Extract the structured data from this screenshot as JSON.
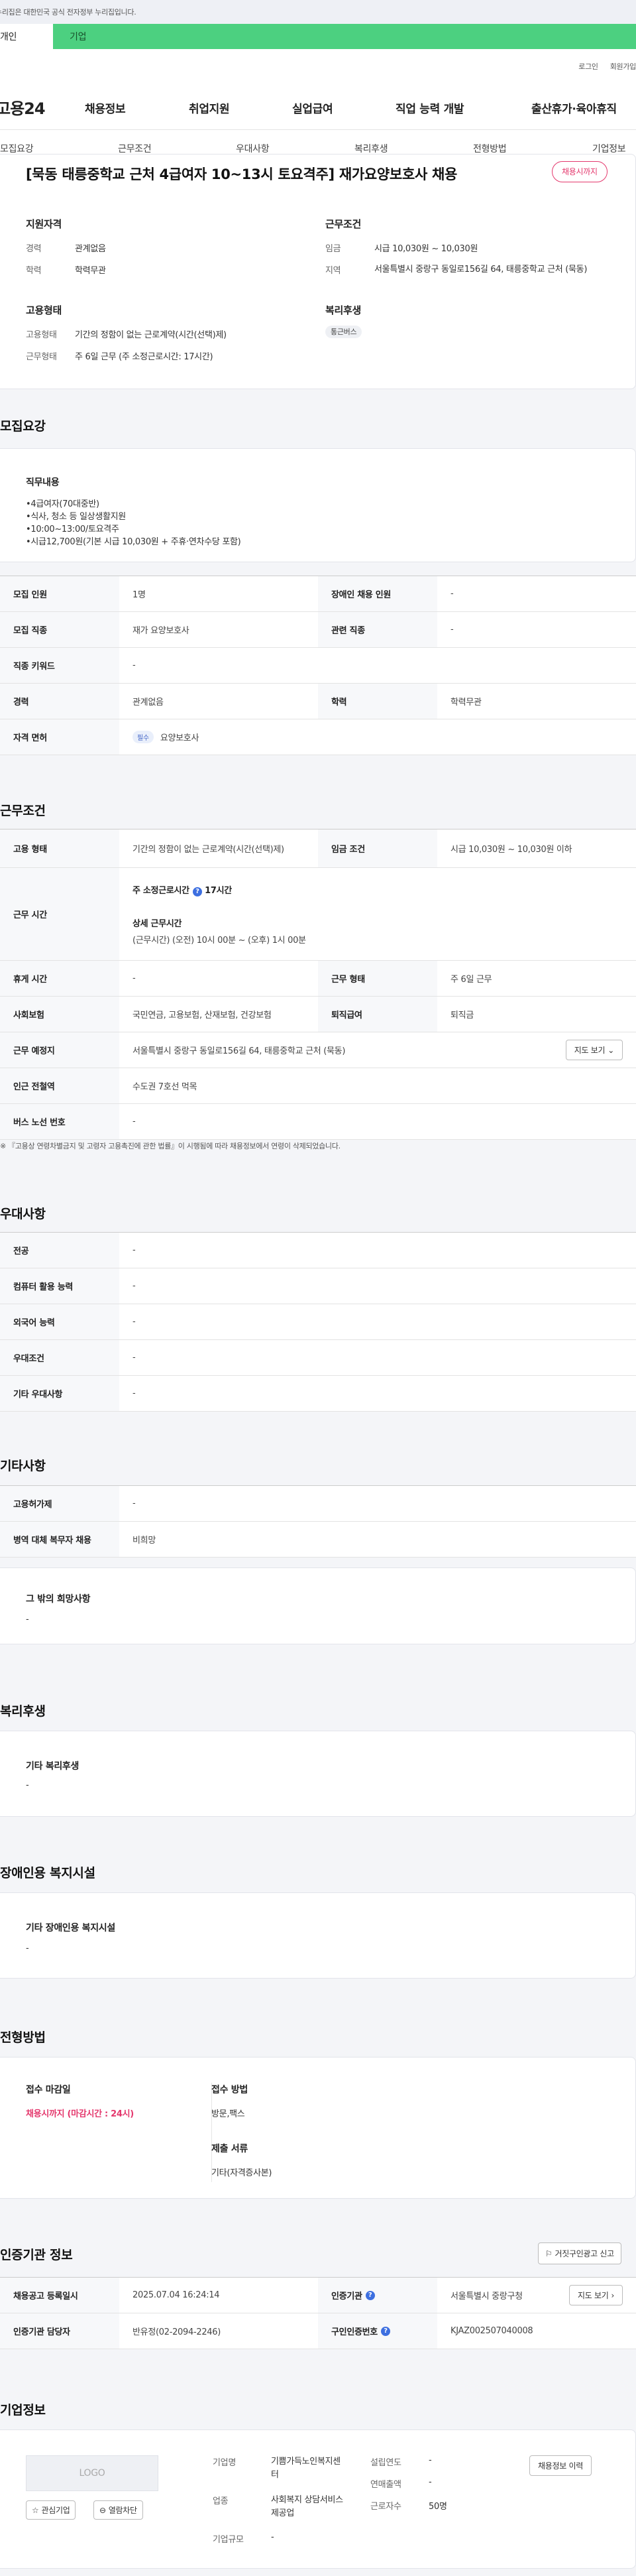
{
  "gov_banner": "이 누리집은 대한민국 공식 전자정부 누리집입니다.",
  "service_tabs": [
    "개인",
    "기업"
  ],
  "utility": [
    "로그인",
    "회원가입"
  ],
  "logo": "고용24",
  "gnb": [
    "채용정보",
    "취업지원",
    "실업급여",
    "직업 능력 개발",
    "출산휴가·육아휴직"
  ],
  "tabs": [
    "모집요강",
    "근무조건",
    "우대사항",
    "복리후생",
    "전형방법",
    "기업정보"
  ],
  "job": {
    "title": "[묵동 태릉중학교 근처 4급여자 10~13시 토요격주] 재가요양보호사 채용",
    "status": "채용시까지",
    "qualification_heading": "지원자격",
    "career_label": "경력",
    "career": "관계없음",
    "education_label": "학력",
    "education": "학력무관",
    "employment_heading": "고용형태",
    "emp_type_label": "고용형태",
    "emp_type": "기간의 정함이 없는 근로계약(시간(선택)제)",
    "work_form_label": "근무형태",
    "work_form": "주 6일 근무 (주 소정근로시간: 17시간)",
    "conditions_heading": "근무조건",
    "wage_label": "임금",
    "wage": "시급 10,030원 ~ 10,030원",
    "region_label": "지역",
    "region": "서울특별시 중랑구 동일로156길 64, 태릉중학교 근처 (묵동)",
    "welfare_heading": "복리후생",
    "welfare_tag": "통근버스"
  },
  "recruit": {
    "section": "모집요강",
    "duty_heading": "직무내용",
    "duty_lines": [
      "•4급여자(70대중반)",
      "•식사, 청소 등 일상생활지원",
      "•10:00~13:00/토요격주",
      "•시급12,700원(기본 시급 10,030원 + 주휴·연차수당 포함)"
    ],
    "rows": [
      {
        "k1": "모집 인원",
        "v1": "1명",
        "k2": "장애인 채용 인원",
        "v2": "-"
      },
      {
        "k1": "모집 직종",
        "v1": "재가 요양보호사",
        "k2": "관련 직종",
        "v2": "-"
      }
    ],
    "keyword_label": "직종 키워드",
    "keyword": "-",
    "career_label": "경력",
    "career": "관계없음",
    "edu_label": "학력",
    "edu": "학력무관",
    "license_label": "자격 면허",
    "license_tag": "필수",
    "license": "요양보호사"
  },
  "work": {
    "section": "근무조건",
    "emp_label": "고용 형태",
    "emp": "기간의 정함이 없는 근로계약(시간(선택)제)",
    "wage_label": "임금 조건",
    "wage": "시급 10,030원 ~ 10,030원 이하",
    "hours_label": "근무 시간",
    "weekly_label": "주 소정근로시간",
    "weekly": "17시간",
    "detail_label": "상세 근무시간",
    "detail": "(근무시간) (오전) 10시 00분 ~ (오후) 1시 00분",
    "break_label": "휴게 시간",
    "break": "-",
    "form_label": "근무 형태",
    "form": "주 6일 근무",
    "insurance_label": "사회보험",
    "insurance": "국민연금, 고용보험, 산재보험, 건강보험",
    "severance_label": "퇴직급여",
    "severance": "퇴직금",
    "place_label": "근무 예정지",
    "place": "서울특별시 중랑구 동일로156길 64, 태릉중학교 근처 (묵동)",
    "map_btn": "지도 보기",
    "subway_label": "인근 전철역",
    "subway": "수도권 7호선 먹목",
    "bus_label": "버스 노선 번호",
    "bus": "-",
    "note": "※ 『고용상 연령차별금지 및 고령자 고용촉진에 관한 법률』이 시행됨에 따라 채용정보에서 연령이 삭제되었습니다."
  },
  "pref": {
    "section": "우대사항",
    "rows": [
      {
        "k": "전공",
        "v": "-"
      },
      {
        "k": "컴퓨터 활용 능력",
        "v": "-"
      },
      {
        "k": "외국어 능력",
        "v": "-"
      },
      {
        "k": "우대조건",
        "v": "-"
      },
      {
        "k": "기타 우대사항",
        "v": "-"
      }
    ]
  },
  "etc": {
    "section": "기타사항",
    "rows": [
      {
        "k": "고용허가제",
        "v": "-"
      },
      {
        "k": "병역 대체 복무자 채용",
        "v": "비희망"
      }
    ],
    "other_heading": "그 밖의 희망사항",
    "other": "-"
  },
  "benefit": {
    "section": "복리후생",
    "heading": "기타 복리후생",
    "value": "-"
  },
  "disability": {
    "section": "장애인용 복지시설",
    "heading": "기타 장애인용 복지시설",
    "value": "-"
  },
  "selection": {
    "section": "전형방법",
    "deadline_label": "접수 마감일",
    "deadline": "채용시까지 (마감시간 : 24시)",
    "method_label": "접수 방법",
    "method": "방문,팩스",
    "docs_label": "제출 서류",
    "docs": "기타(자격증사본)"
  },
  "cert": {
    "section": "인증기관 정보",
    "report_btn": "거짓구인광고 신고",
    "reg_label": "채용공고 등록일시",
    "reg": "2025.07.04 16:24:14",
    "org_label": "인증기관",
    "org": "서울특별시 중랑구청",
    "contact_label": "인증기관 담당자",
    "contact": "반유정(02-2094-2246)",
    "num_label": "구인인증번호",
    "num": "KJAZ002507040008",
    "map_btn": "지도 보기"
  },
  "company": {
    "section": "기업정보",
    "logo": "LOGO",
    "fav": "관심기업",
    "block": "열람차단",
    "name_label": "기업명",
    "name": "기쁨가득노인복지센터",
    "industry_label": "업종",
    "industry": "사회복지 상담서비스 제공업",
    "scale_label": "기업규모",
    "scale": "-",
    "founded_label": "설립연도",
    "founded": "-",
    "sales_label": "연매출액",
    "sales": "-",
    "employees_label": "근로자수",
    "employees": "50명",
    "history_btn": "채용정보 이력"
  },
  "colors": {
    "green": "#4cd080",
    "accent": "#e4386d",
    "blue": "#3d6fe0"
  }
}
